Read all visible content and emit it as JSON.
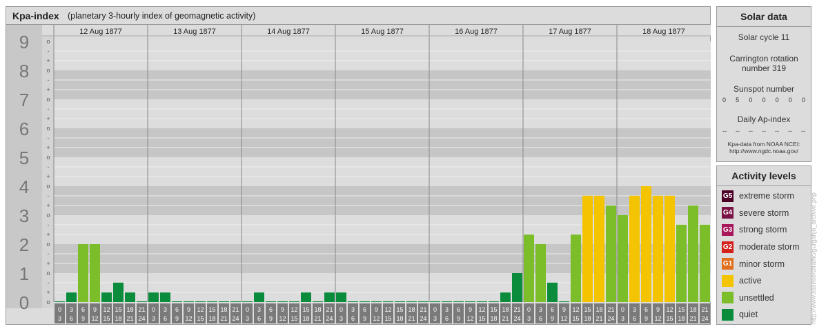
{
  "header": {
    "title": "Kpa-index",
    "subtitle": "(planetary 3-hourly index of geomagnetic activity)"
  },
  "chart_data": {
    "type": "bar",
    "title": "Kpa-index",
    "subtitle": "(planetary 3-hourly index of geomagnetic activity)",
    "ylim": [
      0,
      9
    ],
    "y_ticks": [
      "0",
      "1",
      "2",
      "3",
      "4",
      "5",
      "6",
      "7",
      "8",
      "9"
    ],
    "y_minor_marks": [
      "-",
      "+",
      "o"
    ],
    "days": [
      "12 Aug 1877",
      "13 Aug 1877",
      "14 Aug 1877",
      "15 Aug 1877",
      "16 Aug 1877",
      "17 Aug 1877",
      "18 Aug 1877"
    ],
    "intervals": [
      {
        "start": "0",
        "end": "3"
      },
      {
        "start": "3",
        "end": "6"
      },
      {
        "start": "6",
        "end": "9"
      },
      {
        "start": "9",
        "end": "12"
      },
      {
        "start": "12",
        "end": "15"
      },
      {
        "start": "15",
        "end": "18"
      },
      {
        "start": "18",
        "end": "21"
      },
      {
        "start": "21",
        "end": "24"
      }
    ],
    "values": [
      [
        0.0,
        0.33,
        2.0,
        2.0,
        0.33,
        0.67,
        0.33,
        0.0
      ],
      [
        0.33,
        0.33,
        0.0,
        0.0,
        0.0,
        0.0,
        0.0,
        0.0
      ],
      [
        0.0,
        0.33,
        0.0,
        0.0,
        0.0,
        0.33,
        0.0,
        0.33
      ],
      [
        0.33,
        0.0,
        0.0,
        0.0,
        0.0,
        0.0,
        0.0,
        0.0
      ],
      [
        0.0,
        0.0,
        0.0,
        0.0,
        0.0,
        0.0,
        0.33,
        1.0
      ],
      [
        2.33,
        2.0,
        0.67,
        0.0,
        2.33,
        3.67,
        3.67,
        3.33
      ],
      [
        3.0,
        3.67,
        4.0,
        3.67,
        3.67,
        2.67,
        3.33,
        2.67
      ]
    ],
    "color_thresholds": [
      {
        "min": 4.5,
        "color": "#d6001c",
        "level": "minor storm"
      },
      {
        "min": 3.5,
        "color": "#f5c400",
        "level": "active"
      },
      {
        "min": 1.5,
        "color": "#7cbd2a",
        "level": "unsettled"
      },
      {
        "min": 0,
        "color": "#0a8c3c",
        "level": "quiet"
      }
    ]
  },
  "solar": {
    "heading": "Solar data",
    "cycle": "Solar cycle 11",
    "carrington_1": "Carrington rotation",
    "carrington_2": "number 319",
    "sunspot_label": "Sunspot number",
    "sunspots": [
      "0",
      "5",
      "0",
      "0",
      "0",
      "0",
      "0"
    ],
    "ap_label": "Daily Ap-index",
    "ap": [
      "--",
      "--",
      "--",
      "--",
      "--",
      "--",
      "--"
    ],
    "source_1": "Kpa-data from NOAA NCEI:",
    "source_2": "http://www.ngdc.noaa.gov/"
  },
  "activity": {
    "heading": "Activity levels",
    "levels": [
      {
        "badge": "G5",
        "label": "extreme storm",
        "color": "#4d0026"
      },
      {
        "badge": "G4",
        "label": "severe storm",
        "color": "#7a1246"
      },
      {
        "badge": "G3",
        "label": "strong storm",
        "color": "#a8175a"
      },
      {
        "badge": "G2",
        "label": "moderate storm",
        "color": "#d6201c"
      },
      {
        "badge": "G1",
        "label": "minor storm",
        "color": "#e0701c"
      },
      {
        "badge": "",
        "label": "active",
        "color": "#f5c400"
      },
      {
        "badge": "",
        "label": "unsettled",
        "color": "#7cbd2a"
      },
      {
        "badge": "",
        "label": "quiet",
        "color": "#0a8c3c"
      }
    ]
  },
  "credit": "http://www.lisaeserdtraffic/gurgahjo_archive.php"
}
